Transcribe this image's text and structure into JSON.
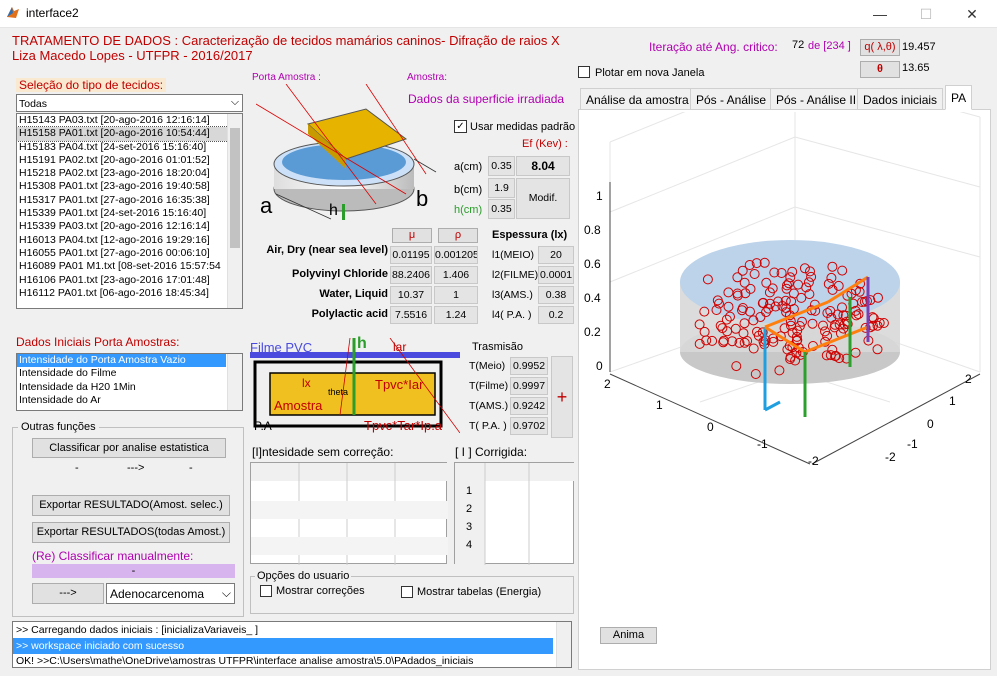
{
  "window": {
    "title": "interface2",
    "minimize": "—",
    "maximize": "☐",
    "close": "✕"
  },
  "header": {
    "line1": "TRATAMENTO DE DADOS : Caracterização de tecidos mamários caninos- Difração de raios X",
    "line2": "Liza Macedo Lopes - UTFPR - 2016/2017",
    "iter_label": "Iteração até Ang. critico:",
    "iter_value": "72",
    "iter_of": "de [234 ]",
    "q_button": "q( λ,θ)",
    "q_value": "19.457",
    "theta_button": "θ",
    "theta_value": "13.65"
  },
  "tissue": {
    "label": "Seleção do tipo de tecidos:",
    "select_value": "Todas",
    "files": [
      "H15143 PA03.txt [20-ago-2016 12:16:14]",
      "H15158 PA01.txt [20-ago-2016 10:54:44]",
      "H15183 PA04.txt [24-set-2016 15:16:40]",
      "H15191 PA02.txt [20-ago-2016 01:01:52]",
      "H15218 PA02.txt [23-ago-2016 18:20:04]",
      "H15308 PA01.txt [23-ago-2016 19:40:58]",
      "H15317 PA01.txt [27-ago-2016 16:35:38]",
      "H15339 PA01.txt [24-set-2016 15:16:40]",
      "H15339 PA03.txt [20-ago-2016 12:16:14]",
      "H16013 PA04.txt [12-ago-2016 19:29:16]",
      "H16055 PA01.txt [27-ago-2016 00:06:10]",
      "H16089 PA01 M1.txt [08-set-2016 15:57:54",
      "H16106 PA01.txt [23-ago-2016 17:01:48]",
      "H16112 PA01.txt [06-ago-2016 18:45:34]"
    ]
  },
  "initial": {
    "label": "Dados Iniciais Porta Amostras:",
    "items": [
      "Intensidade do Porta Amostra Vazio",
      "Intensidade do Filme",
      "Intensidade da H20 1Min",
      "Intensidade do Ar"
    ]
  },
  "other": {
    "title": "Outras funções",
    "classify_btn": "Classificar por analise estatistica",
    "dash1": "-",
    "arrow": "--->",
    "dash2": "-",
    "export_sel": "Exportar RESULTADO(Amost. selec.)",
    "export_all": "Exportar RESULTADOS(todas Amost.)",
    "reclass_label": "(Re) Classificar manualmente:",
    "reclass_value": "-",
    "go_btn": "--->",
    "class_select": "Adenocarcenoma"
  },
  "sample": {
    "porta_label": "Porta Amostra :",
    "amostra_label": "Amostra:",
    "surface_label": "Dados da superficie irradiada",
    "use_std": "Usar medidas padrão",
    "ef_label": "Ef (Kev) :",
    "a_label": "a(cm)",
    "a_val": "0.35",
    "b_label": "b(cm)",
    "b_val": "1.9",
    "h_label": "h(cm)",
    "h_val": "0.35",
    "ef_val": "8.04",
    "modif_btn": "Modif.",
    "diag_a": "a",
    "diag_b": "b",
    "diag_h": "h"
  },
  "materials": {
    "mu_btn": "μ",
    "rho_btn": "ρ",
    "names": [
      "Air, Dry (near sea level)",
      "Polyvinyl Chloride",
      "Water, Liquid",
      "Polylactic acid"
    ],
    "mu": [
      "0.01195",
      "88.2406",
      "10.37",
      "7.5516"
    ],
    "rho": [
      "0.001205",
      "1.406",
      "1",
      "1.24"
    ]
  },
  "thickness": {
    "title": "Espessura (lx)",
    "labels": [
      "l1(MEIO)",
      "l2(FILME)",
      "l3(AMS.)",
      "l4( P.A. )"
    ],
    "values": [
      "20",
      "0.0001",
      "0.38",
      "0.2"
    ]
  },
  "transmission": {
    "title": "Trasmisão",
    "labels": [
      "T(Meio)",
      "T(Filme)",
      "T(AMS.)",
      "T( P.A. )"
    ],
    "values": [
      "0.9952",
      "0.9997",
      "0.9242",
      "0.9702"
    ],
    "plus": "+"
  },
  "diagram2": {
    "filme": "Filme PVC",
    "h": "h",
    "lar": "lar",
    "ix": "lx",
    "theta": "theta",
    "amostra": "Amostra",
    "tpvc": "Tpvc*Iar",
    "pa": "P.A",
    "tpvc_full": "Tpvc*Tar*Ip.a"
  },
  "tables": {
    "left_label": "[I]ntesidade sem correção:",
    "right_label": "[ I ] Corrigida:",
    "right_rows": [
      "1",
      "2",
      "3",
      "4"
    ]
  },
  "options": {
    "title": "Opções do usuario",
    "show_corr": "Mostrar correções",
    "show_tables": "Mostrar tabelas (Energia)"
  },
  "console": {
    "lines": [
      ">> Carregando dados iniciais : [inicializaVariaveis_ ]",
      ">> workspace iniciado com sucesso",
      "OK! >>C:\\Users\\mathe\\OneDrive\\amostras UTFPR\\interface analise amostra\\5.0\\PAdados_iniciais"
    ]
  },
  "right": {
    "plot_new": "Plotar em nova Janela",
    "tabs": [
      "Análise da amostra",
      "Pós - Análise",
      "Pós - Análise II",
      "Dados iniciais",
      "PA"
    ],
    "anima_btn": "Anima",
    "z_ticks": [
      "1",
      "0.8",
      "0.6",
      "0.4",
      "0.2",
      "0"
    ],
    "x_ticks": [
      "2",
      "1",
      "0",
      "-1",
      "-2"
    ],
    "y_ticks": [
      "2",
      "1",
      "0",
      "-1",
      "-2"
    ]
  }
}
